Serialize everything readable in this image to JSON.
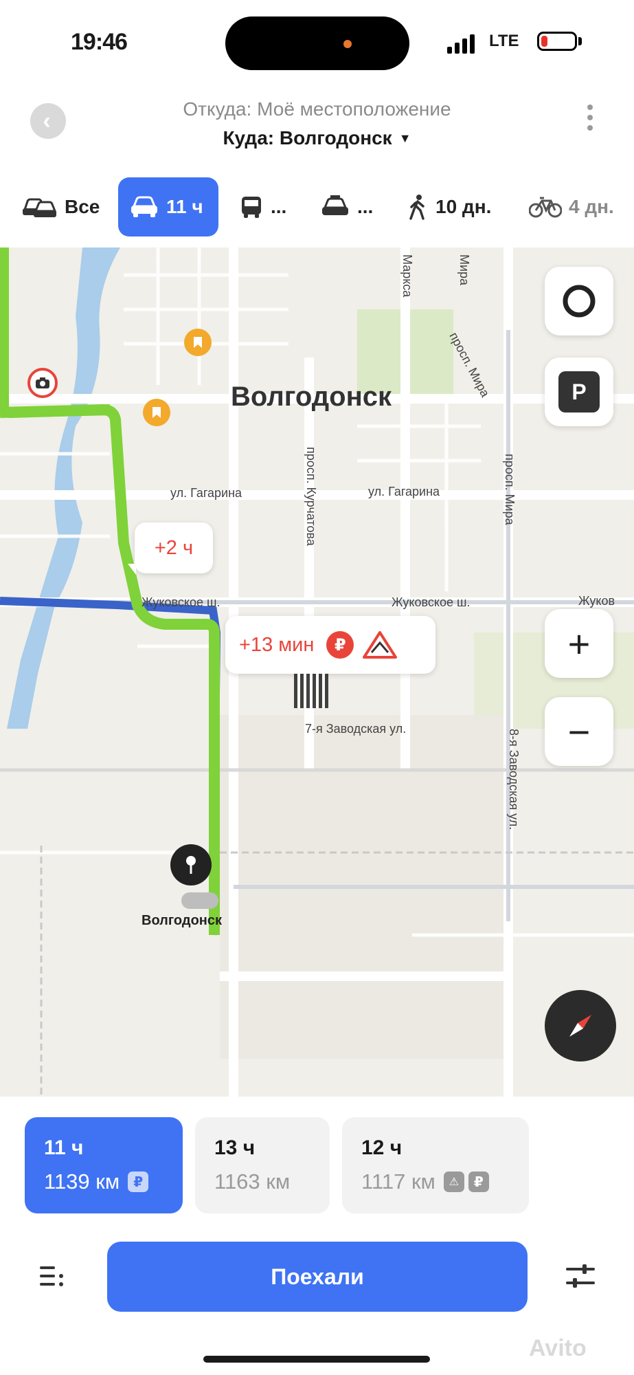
{
  "status": {
    "time": "19:46",
    "network": "LTE",
    "battery_level": 0.2
  },
  "header": {
    "from": "Откуда: Моё местоположение",
    "to": "Куда: Волгодонск"
  },
  "tabs": [
    {
      "label": "Все",
      "icon": "cars-icon",
      "active": false
    },
    {
      "label": "11 ч",
      "icon": "car-icon",
      "active": true
    },
    {
      "label": "...",
      "icon": "bus-icon",
      "active": false
    },
    {
      "label": "...",
      "icon": "taxi-icon",
      "active": false
    },
    {
      "label": "10 дн.",
      "icon": "pedestrian-icon",
      "active": false
    },
    {
      "label": "4 дн.",
      "icon": "bicycle-icon",
      "active": false
    }
  ],
  "map": {
    "city": "Волгодонск",
    "streets": {
      "marksa": "Маркса",
      "mira_top": "Мира",
      "prosp_mira_1": "просп. Мира",
      "prosp_mira_2": "просп. Мира",
      "gagarina_1": "ул. Гагарина",
      "gagarina_2": "ул. Гагарина",
      "kurchatova": "просп. Курчатова",
      "zhukovskoe_1": "Жуковское ш.",
      "zhukovskoe_2": "Жуковское ш.",
      "zhukovskoe_3": "Жуков",
      "zavodskaya_7": "7-я Заводская ул.",
      "zavodskaya_8": "8-я Заводская ул."
    },
    "bubble_alt_route": "+2 ч",
    "bubble_delay": "+13 мин",
    "bubble_delay_toll": "₽",
    "parking_label": "P",
    "destination_label": "Волгодонск",
    "zoom_in": "+",
    "zoom_out": "−",
    "colors": {
      "route_main": "#7fd23a",
      "route_alt": "#3a63c9",
      "accent": "#3f73f4",
      "warning": "#e8443a"
    }
  },
  "routes": [
    {
      "time": "11 ч",
      "distance": "1139 км",
      "badges": [
        "₽"
      ],
      "active": true
    },
    {
      "time": "13 ч",
      "distance": "1163 км",
      "badges": [],
      "active": false
    },
    {
      "time": "12 ч",
      "distance": "1117 км",
      "badges": [
        "⚠",
        "₽"
      ],
      "active": false
    }
  ],
  "bottom": {
    "go_label": "Поехали"
  },
  "watermark": "Avito"
}
